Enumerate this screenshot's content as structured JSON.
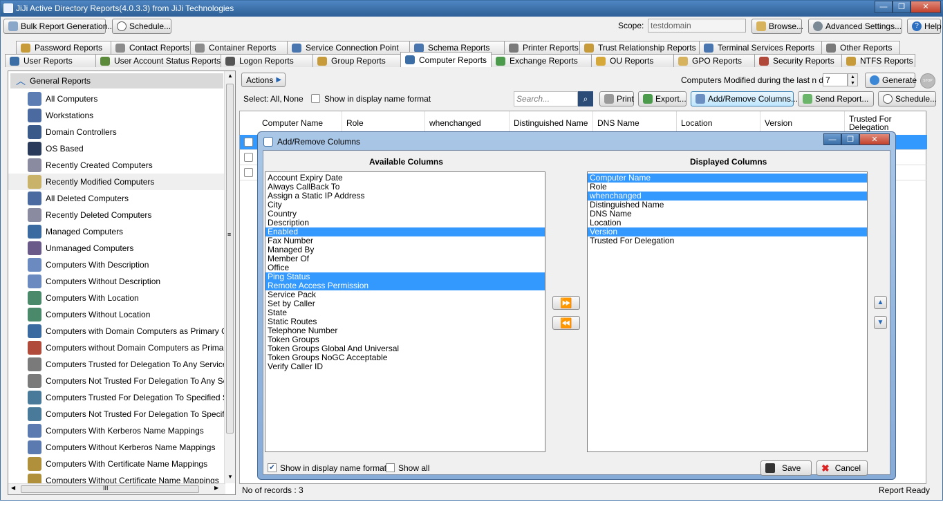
{
  "window": {
    "title": "JiJi Active Directory Reports(4.0.3.3) from JiJi Technologies"
  },
  "toolbar": {
    "bulk_label": "Bulk Report Generation...",
    "schedule_label": "Schedule...",
    "scope_label": "Scope:",
    "scope_value": "testdomain",
    "browse_label": "Browse...",
    "advanced_label": "Advanced  Settings...",
    "help_label": "Help"
  },
  "tabs_row1": [
    "Password Reports",
    "Contact Reports",
    "Container Reports",
    "Service Connection Point",
    "Schema Reports",
    "Printer Reports",
    "Trust Relationship Reports",
    "Terminal Services Reports",
    "Other Reports"
  ],
  "tabs_row2": [
    "User Reports",
    "User Account Status Reports",
    "Logon Reports",
    "Group Reports",
    "Computer Reports",
    "Exchange Reports",
    "OU Reports",
    "GPO Reports",
    "Security Reports",
    "NTFS Reports"
  ],
  "sidebar": {
    "header": "General Reports",
    "items": [
      "All Computers",
      "Workstations",
      "Domain Controllers",
      "OS Based",
      "Recently Created Computers",
      "Recently Modified Computers",
      "All Deleted Computers",
      "Recently Deleted Computers",
      "Managed Computers",
      "Unmanaged Computers",
      "Computers With Description",
      "Computers Without Description",
      "Computers With Location",
      "Computers Without Location",
      "Computers with Domain Computers as Primary Group",
      "Computers without Domain Computers as Primary Grou",
      "Computers Trusted for Delegation To Any Service",
      "Computers Not Trusted For Delegation To Any Service",
      "Computers Trusted For Delegation To Specified Servic",
      "Computers Not Trusted For Delegation To Specified S",
      "Computers With Kerberos Name Mappings",
      "Computers Without Kerberos Name Mappings",
      "Computers With Certificate Name Mappings",
      "Computers Without Certificate Name Mappings"
    ],
    "selected_index": 5,
    "hscroll_glyph": "III",
    "vscroll_glyph": "≡"
  },
  "main": {
    "actions_label": "Actions",
    "modified_label": "Computers Modified during the last n days:",
    "days_value": "7",
    "generate_label": "Generate",
    "stop_label": "STOP",
    "select_label": "Select:",
    "select_all": "All,",
    "select_none": "None",
    "display_name_label": "Show in display name format",
    "search_placeholder": "Search...",
    "print_label": "Print",
    "export_label": "Export...",
    "addremove_label": "Add/Remove Columns...",
    "sendreport_label": "Send Report...",
    "schedule_label": "Schedule...",
    "columns": [
      "Computer Name",
      "Role",
      "whenchanged",
      "Distinguished Name",
      "DNS Name",
      "Location",
      "Version",
      "Trusted For Delegation"
    ],
    "records_label": "No of records : 3",
    "status": "Report Ready"
  },
  "dialog": {
    "title": "Add/Remove Columns",
    "available_title": "Available Columns",
    "displayed_title": "Displayed Columns",
    "available": [
      "Account Expiry Date",
      "Always CallBack To",
      "Assign a Static IP Address",
      "City",
      "Country",
      "Description",
      "Enabled",
      "Fax Number",
      "Managed By",
      "Member Of",
      "Office",
      "Ping Status",
      "Remote Access Permission",
      "Service Pack",
      "Set by Caller",
      "State",
      "Static Routes",
      "Telephone Number",
      "Token Groups",
      "Token Groups Global And Universal",
      "Token Groups NoGC Acceptable",
      "Verify Caller ID"
    ],
    "available_selected": [
      6,
      11,
      12
    ],
    "displayed": [
      "Computer Name",
      "Role",
      "whenchanged",
      "Distinguished Name",
      "DNS Name",
      "Location",
      "Version",
      "Trusted For Delegation"
    ],
    "displayed_selected": [
      0,
      2,
      6
    ],
    "show_display_name": "Show in display name format",
    "show_display_name_checked": true,
    "show_all": "Show all",
    "show_all_checked": false,
    "save_label": "Save",
    "cancel_label": "Cancel"
  }
}
